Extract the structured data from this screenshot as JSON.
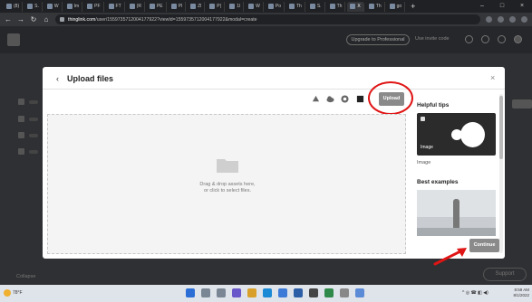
{
  "browser": {
    "tabs": [
      {
        "label": "(8)"
      },
      {
        "label": "S."
      },
      {
        "label": "W"
      },
      {
        "label": "Im"
      },
      {
        "label": "PF"
      },
      {
        "label": "FT"
      },
      {
        "label": "(R"
      },
      {
        "label": "PE"
      },
      {
        "label": "Pl"
      },
      {
        "label": "Zl"
      },
      {
        "label": "P("
      },
      {
        "label": "1l"
      },
      {
        "label": "W"
      },
      {
        "label": "Po"
      },
      {
        "label": "Th"
      },
      {
        "label": "S."
      },
      {
        "label": "Th"
      },
      {
        "label": "X",
        "active": true
      },
      {
        "label": "Th"
      },
      {
        "label": "go"
      }
    ],
    "new_tab": "+",
    "url_host": "thinglink.com",
    "url_path": "/user/1559735712004177922?viewId=1559735712004177922&modal=create"
  },
  "app": {
    "upgrade_label": "Upgrade to Professional",
    "invite_label": "Use invite code",
    "bottom_left_label": "Collapse",
    "support_label": "Support"
  },
  "modal": {
    "back_symbol": "‹",
    "title": "Upload files",
    "close_symbol": "×",
    "upload_label": "Upload",
    "dropzone_line1": "Drag & drop assets here,",
    "dropzone_line2": "or click to select files.",
    "tips_heading": "Helpful tips",
    "tip_card_label": "Image",
    "tip_caption": "Image",
    "examples_heading": "Best examples",
    "continue_label": "Continue"
  },
  "taskbar": {
    "weather": "78°F",
    "clock_time": "8:59 AM",
    "clock_date": "8/1/2022"
  },
  "colors": {
    "annotation_red": "#e01515",
    "button_gray": "#8a8a8a"
  }
}
